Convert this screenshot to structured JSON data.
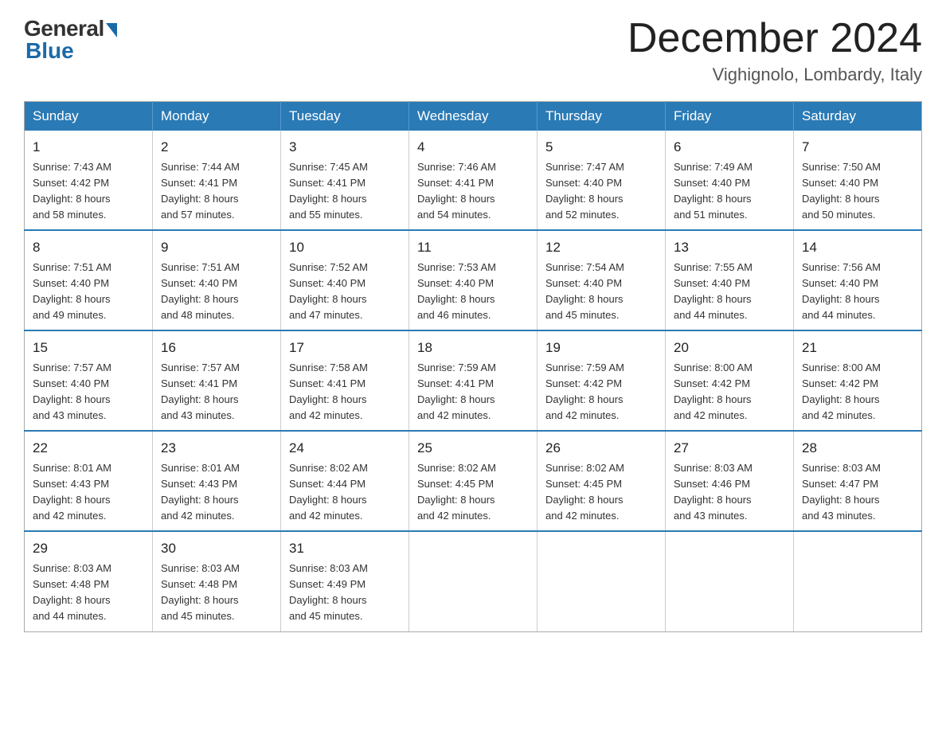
{
  "logo": {
    "general": "General",
    "blue": "Blue"
  },
  "title": {
    "month_year": "December 2024",
    "location": "Vighignolo, Lombardy, Italy"
  },
  "headers": [
    "Sunday",
    "Monday",
    "Tuesday",
    "Wednesday",
    "Thursday",
    "Friday",
    "Saturday"
  ],
  "weeks": [
    [
      {
        "day": "1",
        "sunrise": "7:43 AM",
        "sunset": "4:42 PM",
        "daylight": "8 hours and 58 minutes."
      },
      {
        "day": "2",
        "sunrise": "7:44 AM",
        "sunset": "4:41 PM",
        "daylight": "8 hours and 57 minutes."
      },
      {
        "day": "3",
        "sunrise": "7:45 AM",
        "sunset": "4:41 PM",
        "daylight": "8 hours and 55 minutes."
      },
      {
        "day": "4",
        "sunrise": "7:46 AM",
        "sunset": "4:41 PM",
        "daylight": "8 hours and 54 minutes."
      },
      {
        "day": "5",
        "sunrise": "7:47 AM",
        "sunset": "4:40 PM",
        "daylight": "8 hours and 52 minutes."
      },
      {
        "day": "6",
        "sunrise": "7:49 AM",
        "sunset": "4:40 PM",
        "daylight": "8 hours and 51 minutes."
      },
      {
        "day": "7",
        "sunrise": "7:50 AM",
        "sunset": "4:40 PM",
        "daylight": "8 hours and 50 minutes."
      }
    ],
    [
      {
        "day": "8",
        "sunrise": "7:51 AM",
        "sunset": "4:40 PM",
        "daylight": "8 hours and 49 minutes."
      },
      {
        "day": "9",
        "sunrise": "7:51 AM",
        "sunset": "4:40 PM",
        "daylight": "8 hours and 48 minutes."
      },
      {
        "day": "10",
        "sunrise": "7:52 AM",
        "sunset": "4:40 PM",
        "daylight": "8 hours and 47 minutes."
      },
      {
        "day": "11",
        "sunrise": "7:53 AM",
        "sunset": "4:40 PM",
        "daylight": "8 hours and 46 minutes."
      },
      {
        "day": "12",
        "sunrise": "7:54 AM",
        "sunset": "4:40 PM",
        "daylight": "8 hours and 45 minutes."
      },
      {
        "day": "13",
        "sunrise": "7:55 AM",
        "sunset": "4:40 PM",
        "daylight": "8 hours and 44 minutes."
      },
      {
        "day": "14",
        "sunrise": "7:56 AM",
        "sunset": "4:40 PM",
        "daylight": "8 hours and 44 minutes."
      }
    ],
    [
      {
        "day": "15",
        "sunrise": "7:57 AM",
        "sunset": "4:40 PM",
        "daylight": "8 hours and 43 minutes."
      },
      {
        "day": "16",
        "sunrise": "7:57 AM",
        "sunset": "4:41 PM",
        "daylight": "8 hours and 43 minutes."
      },
      {
        "day": "17",
        "sunrise": "7:58 AM",
        "sunset": "4:41 PM",
        "daylight": "8 hours and 42 minutes."
      },
      {
        "day": "18",
        "sunrise": "7:59 AM",
        "sunset": "4:41 PM",
        "daylight": "8 hours and 42 minutes."
      },
      {
        "day": "19",
        "sunrise": "7:59 AM",
        "sunset": "4:42 PM",
        "daylight": "8 hours and 42 minutes."
      },
      {
        "day": "20",
        "sunrise": "8:00 AM",
        "sunset": "4:42 PM",
        "daylight": "8 hours and 42 minutes."
      },
      {
        "day": "21",
        "sunrise": "8:00 AM",
        "sunset": "4:42 PM",
        "daylight": "8 hours and 42 minutes."
      }
    ],
    [
      {
        "day": "22",
        "sunrise": "8:01 AM",
        "sunset": "4:43 PM",
        "daylight": "8 hours and 42 minutes."
      },
      {
        "day": "23",
        "sunrise": "8:01 AM",
        "sunset": "4:43 PM",
        "daylight": "8 hours and 42 minutes."
      },
      {
        "day": "24",
        "sunrise": "8:02 AM",
        "sunset": "4:44 PM",
        "daylight": "8 hours and 42 minutes."
      },
      {
        "day": "25",
        "sunrise": "8:02 AM",
        "sunset": "4:45 PM",
        "daylight": "8 hours and 42 minutes."
      },
      {
        "day": "26",
        "sunrise": "8:02 AM",
        "sunset": "4:45 PM",
        "daylight": "8 hours and 42 minutes."
      },
      {
        "day": "27",
        "sunrise": "8:03 AM",
        "sunset": "4:46 PM",
        "daylight": "8 hours and 43 minutes."
      },
      {
        "day": "28",
        "sunrise": "8:03 AM",
        "sunset": "4:47 PM",
        "daylight": "8 hours and 43 minutes."
      }
    ],
    [
      {
        "day": "29",
        "sunrise": "8:03 AM",
        "sunset": "4:48 PM",
        "daylight": "8 hours and 44 minutes."
      },
      {
        "day": "30",
        "sunrise": "8:03 AM",
        "sunset": "4:48 PM",
        "daylight": "8 hours and 45 minutes."
      },
      {
        "day": "31",
        "sunrise": "8:03 AM",
        "sunset": "4:49 PM",
        "daylight": "8 hours and 45 minutes."
      },
      null,
      null,
      null,
      null
    ]
  ],
  "day_labels": {
    "sunrise_prefix": "Sunrise: ",
    "sunset_prefix": "Sunset: ",
    "daylight_prefix": "Daylight: "
  }
}
